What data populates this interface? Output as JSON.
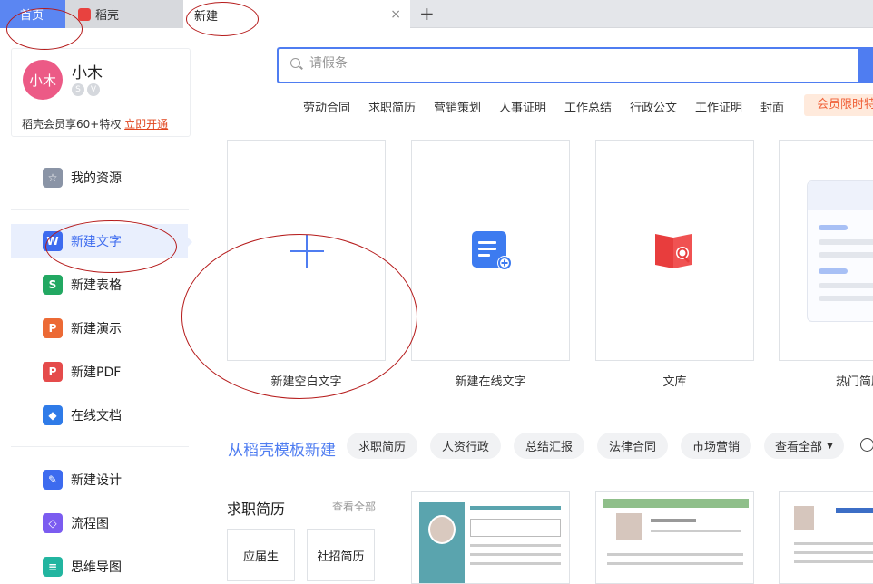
{
  "tabs": {
    "home": "首页",
    "daoke": "稻壳",
    "new": "新建",
    "close_glyph": "×",
    "add_glyph": "+"
  },
  "user": {
    "avatar_text": "小木",
    "name": "小木",
    "promo_text": "稻壳会员享60+特权",
    "promo_link": "立即开通"
  },
  "sidebar": {
    "items": [
      {
        "label": "我的资源",
        "icon": "star-icon",
        "color": "#8a94a6"
      },
      {
        "label": "新建文字",
        "icon": "writer-icon",
        "color": "#3d6bef"
      },
      {
        "label": "新建表格",
        "icon": "spreadsheet-icon",
        "color": "#22a862"
      },
      {
        "label": "新建演示",
        "icon": "presentation-icon",
        "color": "#ec6a35"
      },
      {
        "label": "新建PDF",
        "icon": "pdf-icon",
        "color": "#e54b4b"
      },
      {
        "label": "在线文档",
        "icon": "cloud-doc-icon",
        "color": "#2f7be8"
      },
      {
        "label": "新建设计",
        "icon": "design-icon",
        "color": "#3d6bef"
      },
      {
        "label": "流程图",
        "icon": "flowchart-icon",
        "color": "#7b5cf0"
      },
      {
        "label": "思维导图",
        "icon": "mindmap-icon",
        "color": "#22b5a0"
      }
    ]
  },
  "search": {
    "placeholder": "请假条"
  },
  "hotwords": [
    "劳动合同",
    "求职简历",
    "营销策划",
    "人事证明",
    "工作总结",
    "行政公文",
    "工作证明",
    "封面"
  ],
  "vip_button": "会员限时特",
  "cards": [
    {
      "label": "新建空白文字"
    },
    {
      "label": "新建在线文字"
    },
    {
      "label": "文库"
    },
    {
      "label": "热门简历"
    }
  ],
  "template_section": {
    "title": "从稻壳模板新建",
    "chips": [
      "求职简历",
      "人资行政",
      "总结汇报",
      "法律合同",
      "市场营销",
      "查看全部"
    ]
  },
  "resume_section": {
    "title": "求职简历",
    "more": "查看全部",
    "buttons": [
      "应届生",
      "社招简历"
    ]
  },
  "colors": {
    "accent": "#4f7df1",
    "annotation_red": "#b51a1a"
  }
}
